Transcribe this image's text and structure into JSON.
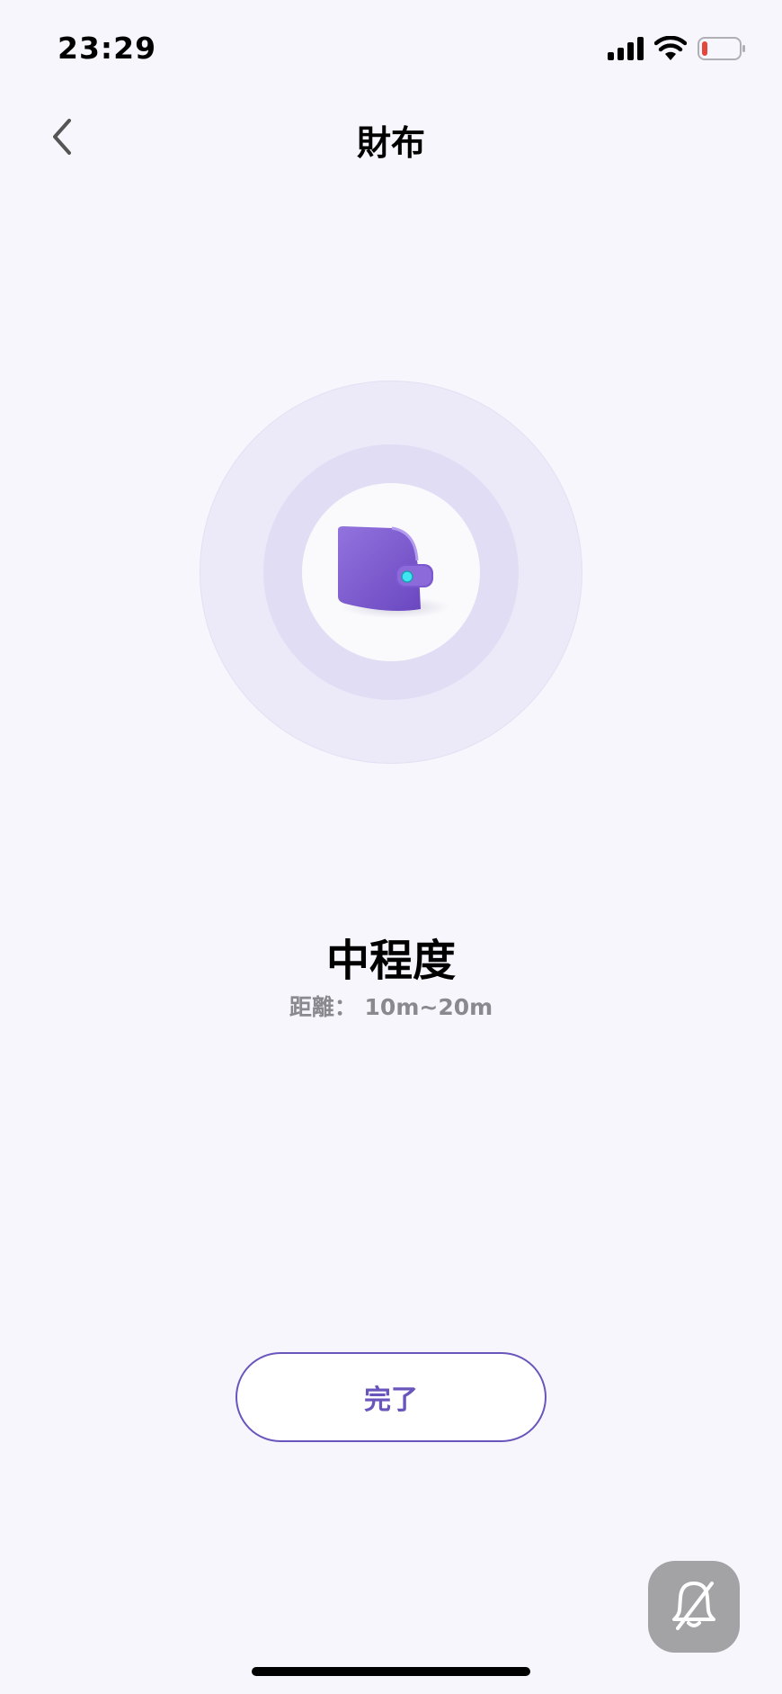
{
  "status_bar": {
    "time": "23:29",
    "icons": [
      "cellular-signal-icon",
      "wifi-icon",
      "battery-low-icon"
    ],
    "battery_level": 0.1,
    "battery_color": "#e5453a"
  },
  "header": {
    "title": "財布",
    "back_icon": "chevron-left-icon"
  },
  "tracker": {
    "device_icon": "wallet-icon",
    "accent_color": "#7d5ad1",
    "range_label": "中程度",
    "distance_text": "距離： 10m~20m"
  },
  "actions": {
    "done_label": "完了",
    "done_color": "#6a55bd",
    "mute_icon": "bell-slash-icon"
  }
}
